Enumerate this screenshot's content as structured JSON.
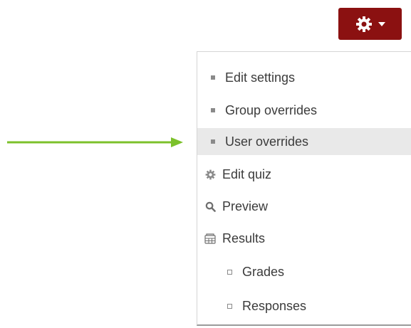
{
  "accent": {
    "button_color": "#8b1111",
    "arrow_color": "#7cc12b",
    "highlight_color": "#e9e9e9"
  },
  "toolbar": {
    "gear_icon": "gear-icon",
    "caret_icon": "caret-down-icon"
  },
  "menu": {
    "items": [
      {
        "label": "Edit settings",
        "icon": "bullet"
      },
      {
        "label": "Group overrides",
        "icon": "bullet"
      },
      {
        "label": "User overrides",
        "icon": "bullet",
        "highlighted": true
      },
      {
        "label": "Edit quiz",
        "icon": "gear-icon"
      },
      {
        "label": "Preview",
        "icon": "magnifier-icon"
      },
      {
        "label": "Results",
        "icon": "table-icon"
      },
      {
        "label": "Grades",
        "icon": "sub-bullet"
      },
      {
        "label": "Responses",
        "icon": "sub-bullet"
      }
    ]
  },
  "annotation": {
    "icon": "right-arrow-icon"
  }
}
